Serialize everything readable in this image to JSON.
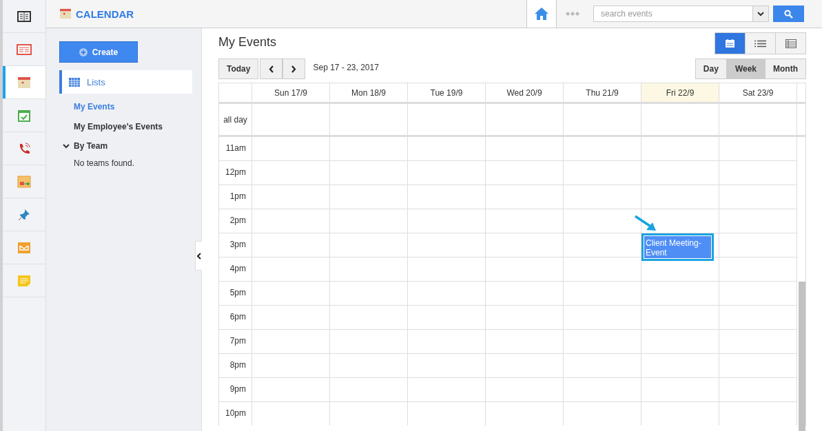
{
  "rail": [
    {
      "selected": false
    },
    {
      "selected": false
    },
    {
      "selected": true
    },
    {
      "selected": false
    },
    {
      "selected": false
    },
    {
      "selected": false
    },
    {
      "selected": false
    },
    {
      "selected": false
    },
    {
      "selected": false
    }
  ],
  "header": {
    "title": "CALENDAR",
    "search": {
      "placeholder": "search events"
    }
  },
  "sidebar": {
    "create": "Create",
    "section": "Lists",
    "items": [
      {
        "label": "My Events",
        "selected": true
      },
      {
        "label": "My Employee's Events",
        "selected": false
      }
    ],
    "group": {
      "label": "By Team",
      "expanded": true,
      "empty": "No teams found."
    }
  },
  "main": {
    "title": "My Events",
    "today": "Today",
    "range": "Sep 17 - 23, 2017",
    "view_icons": [
      {
        "selected": true
      },
      {
        "selected": false
      },
      {
        "selected": false
      }
    ],
    "views": [
      {
        "label": "Day",
        "selected": false
      },
      {
        "label": "Week",
        "selected": true
      },
      {
        "label": "Month",
        "selected": false
      }
    ],
    "days": [
      {
        "label": "Sun 17/9",
        "today": false
      },
      {
        "label": "Mon 18/9",
        "today": false
      },
      {
        "label": "Tue 19/9",
        "today": false
      },
      {
        "label": "Wed 20/9",
        "today": false
      },
      {
        "label": "Thu 21/9",
        "today": false
      },
      {
        "label": "Fri 22/9",
        "today": true
      },
      {
        "label": "Sat 23/9",
        "today": false
      }
    ],
    "all_day": "all day",
    "rows": [
      {
        "time": "11am"
      },
      {
        "time": "12pm"
      },
      {
        "time": "1pm"
      },
      {
        "time": "2pm"
      },
      {
        "time": "3pm",
        "cells": [
          {},
          {},
          {},
          {},
          {},
          {
            "event": "Client Meeting-Event"
          },
          {}
        ]
      },
      {
        "time": "4pm"
      },
      {
        "time": "5pm"
      },
      {
        "time": "6pm"
      },
      {
        "time": "7pm"
      },
      {
        "time": "8pm"
      },
      {
        "time": "9pm"
      },
      {
        "time": "10pm"
      }
    ]
  }
}
